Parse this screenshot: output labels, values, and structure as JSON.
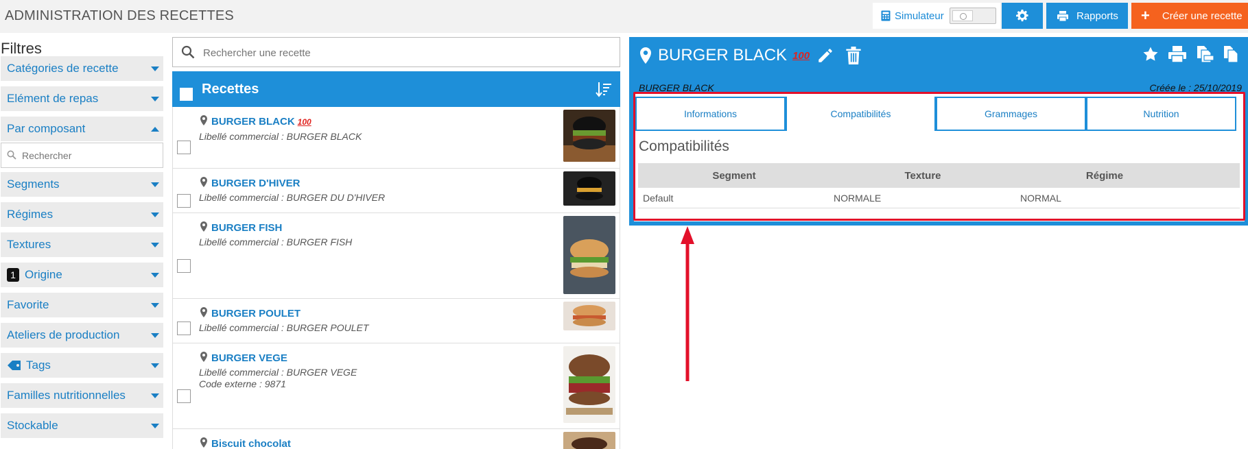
{
  "header": {
    "title": "ADMINISTRATION DES RECETTES",
    "simulator_label": "Simulateur",
    "reports_label": "Rapports",
    "create_label": "Créer une recette"
  },
  "filters": {
    "title": "Filtres",
    "search_placeholder": "Rechercher",
    "origine_badge": "1",
    "items": [
      {
        "label": "Catégories de recette",
        "expanded": false
      },
      {
        "label": "Elément de repas",
        "expanded": false
      },
      {
        "label": "Par composant",
        "expanded": true
      },
      {
        "label": "Segments",
        "expanded": false
      },
      {
        "label": "Régimes",
        "expanded": false
      },
      {
        "label": "Textures",
        "expanded": false
      },
      {
        "label": "Origine",
        "expanded": false
      },
      {
        "label": "Favorite",
        "expanded": false
      },
      {
        "label": "Ateliers de production",
        "expanded": false
      },
      {
        "label": "Tags",
        "expanded": false
      },
      {
        "label": "Familles nutritionnelles",
        "expanded": false
      },
      {
        "label": "Stockable",
        "expanded": false
      }
    ]
  },
  "recipes": {
    "search_placeholder": "Rechercher une recette",
    "header_title": "Recettes",
    "items": [
      {
        "name": "BURGER BLACK",
        "badge": "100",
        "lines": [
          "Libellé commercial : BURGER BLACK"
        ]
      },
      {
        "name": "BURGER D'HIVER",
        "lines": [
          "Libellé commercial : BURGER DU D'HIVER"
        ]
      },
      {
        "name": "BURGER FISH",
        "lines": [
          "Libellé commercial : BURGER FISH"
        ]
      },
      {
        "name": "BURGER POULET",
        "lines": [
          "Libellé commercial : BURGER POULET"
        ]
      },
      {
        "name": "BURGER VEGE",
        "lines": [
          "Libellé commercial : BURGER VEGE",
          "Code externe : 9871"
        ]
      },
      {
        "name": "Biscuit chocolat",
        "lines": []
      }
    ]
  },
  "detail": {
    "title": "BURGER BLACK",
    "title_badge": "100",
    "subtitle": "BURGER BLACK",
    "created": "Créée le : 25/10/2019",
    "tabs": [
      "Informations",
      "Compatibilités",
      "Grammages",
      "Nutrition"
    ],
    "active_tab": "Compatibilités",
    "section_title": "Compatibilités",
    "table": {
      "headers": [
        "Segment",
        "Texture",
        "Régime"
      ],
      "rows": [
        [
          "Default",
          "NORMALE",
          "NORMAL"
        ]
      ]
    }
  },
  "colors": {
    "accent": "#1e8fd9",
    "create": "#f5621e",
    "highlight": "#e3102a",
    "filter_bg": "#ebebeb"
  }
}
